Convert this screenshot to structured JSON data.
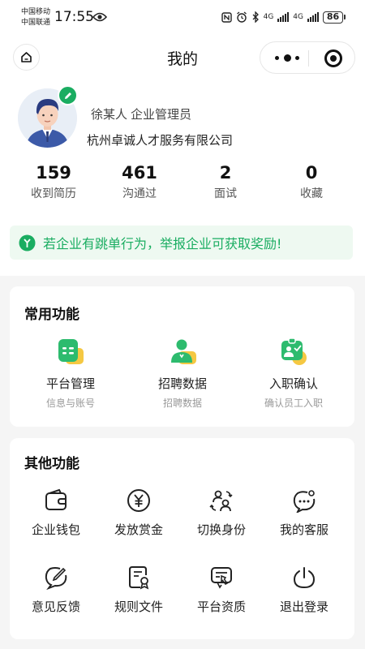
{
  "status_bar": {
    "carrier1": "中国移动",
    "carrier2": "中国联通",
    "time": "17:55",
    "net1": "4G",
    "net2": "4G",
    "battery": "86"
  },
  "nav": {
    "title": "我的"
  },
  "profile": {
    "name": "徐某人",
    "role": "企业管理员",
    "company": "杭州卓诚人才服务有限公司"
  },
  "stats": [
    {
      "value": "159",
      "label": "收到简历"
    },
    {
      "value": "461",
      "label": "沟通过"
    },
    {
      "value": "2",
      "label": "面试"
    },
    {
      "value": "0",
      "label": "收藏"
    }
  ],
  "notice": {
    "text": "若企业有跳单行为，举报企业可获取奖励!"
  },
  "common": {
    "title": "常用功能",
    "items": [
      {
        "label": "平台管理",
        "sub": "信息与账号",
        "icon": "platform-card-icon"
      },
      {
        "label": "招聘数据",
        "sub": "招聘数据",
        "icon": "recruit-person-icon"
      },
      {
        "label": "入职确认",
        "sub": "确认员工入职",
        "icon": "onboard-clipboard-icon"
      }
    ]
  },
  "other": {
    "title": "其他功能",
    "items": [
      {
        "label": "企业钱包",
        "icon": "wallet-icon"
      },
      {
        "label": "发放赏金",
        "icon": "yen-coin-icon"
      },
      {
        "label": "切换身份",
        "icon": "switch-identity-icon"
      },
      {
        "label": "我的客服",
        "icon": "customer-service-icon"
      },
      {
        "label": "意见反馈",
        "icon": "feedback-pen-icon"
      },
      {
        "label": "规则文件",
        "icon": "rule-document-icon"
      },
      {
        "label": "平台资质",
        "icon": "certificate-icon"
      },
      {
        "label": "退出登录",
        "icon": "power-icon"
      }
    ]
  },
  "colors": {
    "accent": "#1aad61",
    "accent_light": "#eef9f1",
    "badge_yellow": "#f5c842",
    "background": "#f5f5f5"
  }
}
